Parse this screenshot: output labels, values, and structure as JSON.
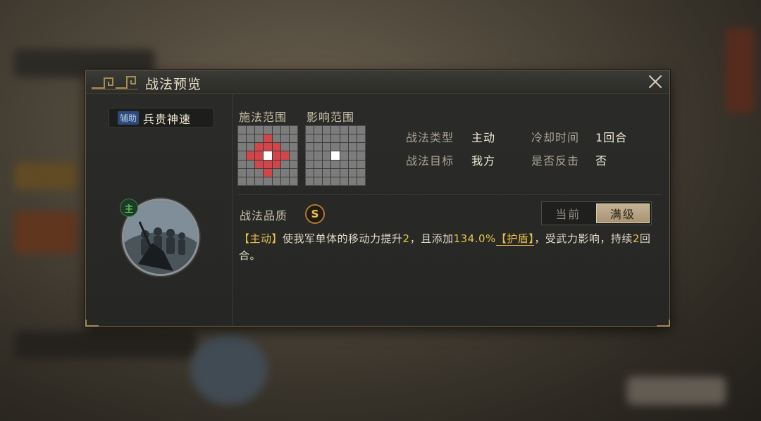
{
  "dialog": {
    "title": "战法预览",
    "close_icon": "close-icon"
  },
  "skill": {
    "category_badge": "辅助",
    "name": "兵贵神速",
    "type_badge": "主"
  },
  "ranges": {
    "cast_label": "施法范围",
    "effect_label": "影响范围"
  },
  "info": {
    "type_label": "战法类型",
    "type_value": "主动",
    "cooldown_label": "冷却时间",
    "cooldown_value": "1回合",
    "target_label": "战法目标",
    "target_value": "我方",
    "counter_label": "是否反击",
    "counter_value": "否"
  },
  "quality": {
    "label": "战法品质",
    "grade": "S"
  },
  "toggle": {
    "current": "当前",
    "max": "满级",
    "selected": "满级"
  },
  "description": {
    "p1": "【主动】",
    "p2": "使我军单体的移动力提升",
    "p3": "2",
    "p4": "，且添加",
    "p5": "134.0%",
    "p6": "【护盾】",
    "p7": "，受武力影响，持续",
    "p8": "2",
    "p9": "回合。"
  },
  "colors": {
    "range_cell": "#d2454a",
    "highlight": "#e8c04a",
    "gold_border": "#6b5a3b"
  }
}
